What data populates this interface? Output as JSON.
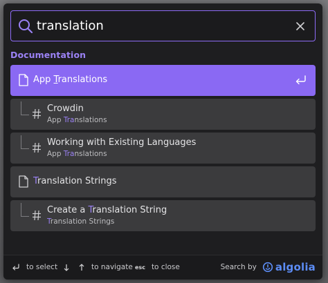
{
  "search": {
    "query": "translation"
  },
  "section": {
    "title": "Documentation"
  },
  "hits": [
    {
      "title_pre": "App ",
      "title_hl": "T",
      "title_post": "ranslations",
      "type": "page",
      "active": true
    },
    {
      "title_pre": "Crowdin",
      "title_hl": "",
      "title_post": "",
      "path_pre": "App ",
      "path_hl": "Tra",
      "path_post": "nslations",
      "type": "section"
    },
    {
      "title_pre": "Working with Existing Languages",
      "title_hl": "",
      "title_post": "",
      "path_pre": "App ",
      "path_hl": "Tra",
      "path_post": "nslations",
      "type": "section"
    },
    {
      "title_pre": "",
      "title_hl": "T",
      "title_post": "ranslation Strings",
      "type": "page"
    },
    {
      "title_pre": "Create a ",
      "title_hl": "T",
      "title_post": "ranslation String",
      "path_pre": "",
      "path_hl": "T",
      "path_post": "ranslation Strings",
      "type": "section"
    }
  ],
  "footer": {
    "select_label": "to select",
    "navigate_label": "to navigate",
    "close_key": "esc",
    "close_label": "to close",
    "search_by_label": "Search by",
    "brand": "algolia"
  },
  "icons": {
    "search": "search-icon",
    "clear": "close-icon",
    "page": "document-icon",
    "section": "hash-icon",
    "enter": "enter-icon",
    "up": "arrow-up-icon",
    "down": "arrow-down-icon",
    "brand": "algolia-icon"
  },
  "colors": {
    "accent": "#8a69f3",
    "highlight": "#9b82f5",
    "panel": "#1e1e20",
    "item": "#3b3b3d",
    "brand": "#5c8cf4"
  }
}
